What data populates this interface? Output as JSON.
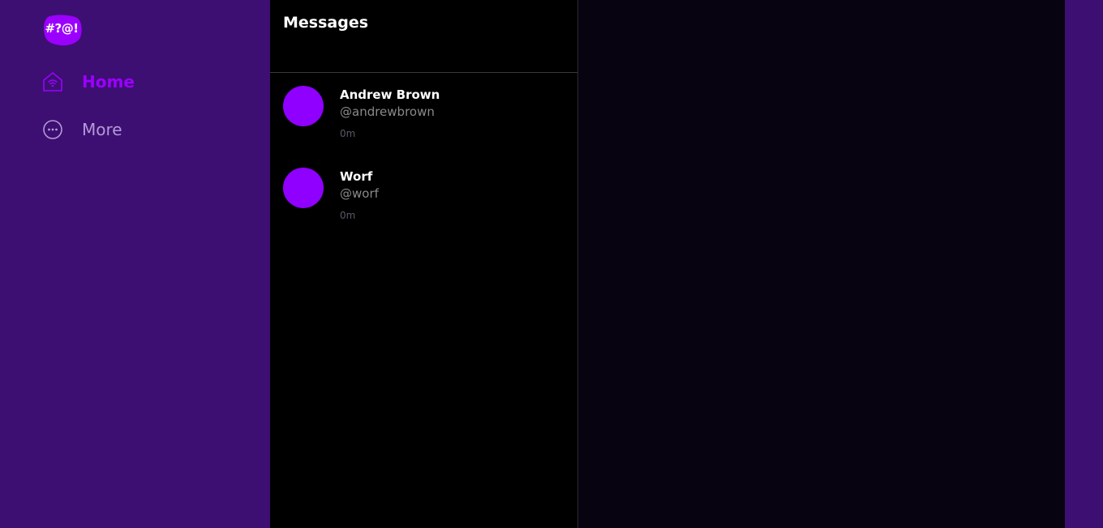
{
  "logo": {
    "text": "#?@!"
  },
  "nav": {
    "items": [
      {
        "label": "Home",
        "icon": "home-wifi-icon",
        "active": true
      },
      {
        "label": "More",
        "icon": "more-dots-icon",
        "active": false
      }
    ]
  },
  "messages": {
    "title": "Messages",
    "conversations": [
      {
        "name": "Andrew Brown",
        "handle": "@andrewbrown",
        "time": "0m"
      },
      {
        "name": "Worf",
        "handle": "@worf",
        "time": "0m"
      }
    ]
  },
  "colors": {
    "sidebar_bg": "#3d0f72",
    "accent": "#9b00ff",
    "avatar": "#9000ff",
    "messages_bg": "#000000",
    "detail_bg": "#080310"
  }
}
